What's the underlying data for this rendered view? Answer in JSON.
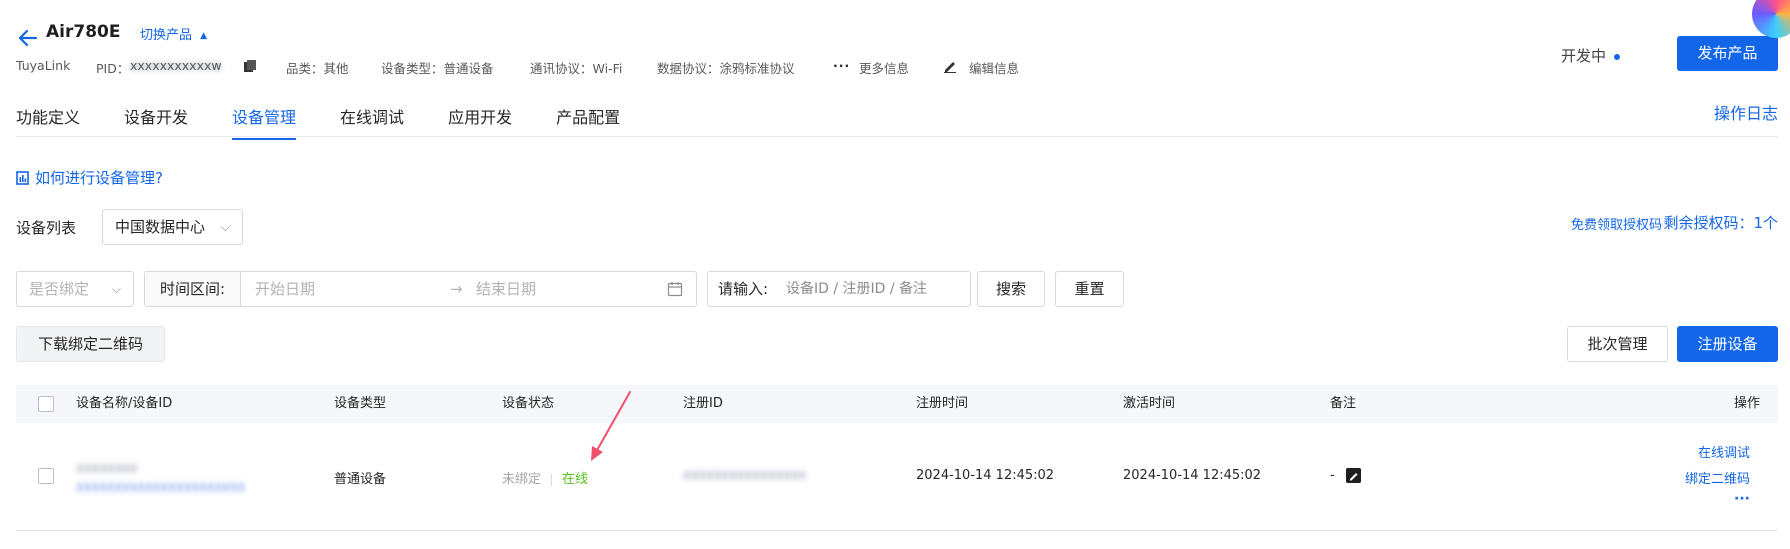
{
  "header": {
    "title": "Air780E",
    "switch_product": "切换产品",
    "meta": {
      "link_type": "TuyaLink",
      "pid_label": "PID：",
      "pid_value": "xxxxxxxxxxxw",
      "category": "品类：其他",
      "device_type": "设备类型：普通设备",
      "comm_protocol": "通讯协议：Wi-Fi",
      "data_protocol": "数据协议：涂鸦标准协议",
      "more_info": "更多信息",
      "edit_info": "编辑信息"
    },
    "dev_status": "开发中",
    "publish_label": "发布产品"
  },
  "tabs": [
    {
      "label": "功能定义",
      "active": false
    },
    {
      "label": "设备开发",
      "active": false
    },
    {
      "label": "设备管理",
      "active": true
    },
    {
      "label": "在线调试",
      "active": false
    },
    {
      "label": "应用开发",
      "active": false
    },
    {
      "label": "产品配置",
      "active": false
    }
  ],
  "operation_log": "操作日志",
  "help_link": "如何进行设备管理?",
  "device_list": {
    "label": "设备列表",
    "region": "中国数据中心",
    "free_auth": "免费领取授权码",
    "remaining_auth": "剩余授权码：1个"
  },
  "filters": {
    "bind_placeholder": "是否绑定",
    "time_range_label": "时间区间:",
    "start_date": "开始日期",
    "arrow": "→",
    "end_date": "结束日期",
    "search_label": "请输入:",
    "search_placeholder": "设备ID / 注册ID / 备注",
    "search_btn": "搜索",
    "reset_btn": "重置"
  },
  "actions": {
    "download_qr": "下载绑定二维码",
    "batch_manage": "批次管理",
    "register_device": "注册设备"
  },
  "table": {
    "columns": [
      "设备名称/设备ID",
      "设备类型",
      "设备状态",
      "注册ID",
      "注册时间",
      "激活时间",
      "备注",
      "操作"
    ],
    "rows": [
      {
        "name": "xxxxxxxx",
        "device_id": "xxxxxxxxxxxxxxxxxxxxxx",
        "type": "普通设备",
        "bind_status": "未绑定",
        "online_status": "在线",
        "register_id": "xxxxxxxxxxxxxxxx",
        "register_time": "2024-10-14 12:45:02",
        "activate_time": "2024-10-14 12:45:02",
        "remark": "-",
        "ops": [
          "在线调试",
          "绑定二维码",
          "···"
        ]
      }
    ]
  },
  "colors": {
    "primary": "#1366e8",
    "online": "#52c41a",
    "annotation_arrow": "#f0506e"
  }
}
